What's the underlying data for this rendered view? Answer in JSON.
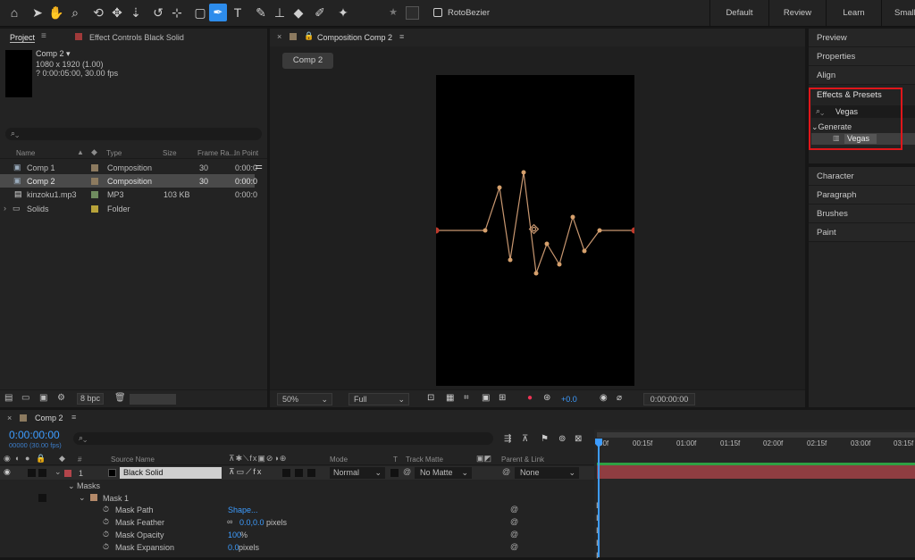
{
  "toolbar": {
    "tool_icons": [
      "home-icon",
      "selection-arrow-icon",
      "hand-icon",
      "zoom-icon",
      "orbit-camera-icon",
      "pan-camera-icon",
      "dolly-camera-icon",
      "rotate-icon",
      "pan-behind-icon",
      "rectangle-icon",
      "pen-icon",
      "type-icon",
      "brush-icon",
      "clone-stamp-icon",
      "eraser-icon",
      "roto-brush-icon",
      "puppet-pin-icon"
    ],
    "rotobezier_label": "RotoBezier",
    "workspaces": [
      "Default",
      "Review",
      "Learn",
      "Small"
    ]
  },
  "project_panel": {
    "tab_project": "Project",
    "tab_effect_controls": "Effect Controls Black Solid",
    "comp_name": "Comp 2",
    "comp_size": "1080 x 1920 (1.00)",
    "comp_duration": "? 0:00:05:00, 30.00 fps",
    "columns": [
      "Name",
      "Type",
      "Size",
      "Frame Ra...",
      "In Point"
    ],
    "items": [
      {
        "name": "Comp 1",
        "type": "Composition",
        "size": "",
        "fps": "30",
        "in": "0:00:0",
        "color": "#8c7a5f"
      },
      {
        "name": "Comp 2",
        "type": "Composition",
        "size": "",
        "fps": "30",
        "in": "0:00:0",
        "color": "#8c7a5f"
      },
      {
        "name": "kinzoku1.mp3",
        "type": "MP3",
        "size": "103 KB",
        "fps": "",
        "in": "0:00:0",
        "color": "#6f8c5f"
      },
      {
        "name": "Solids",
        "type": "Folder",
        "size": "",
        "fps": "",
        "in": "",
        "color": "#b8a33a"
      }
    ],
    "bpc": "8 bpc"
  },
  "viewer": {
    "tab_title": "Composition Comp 2",
    "breadcrumb": "Comp 2",
    "zoom": "50%",
    "resolution": "Full",
    "exposure": "+0.0",
    "timecode": "0:00:00:00"
  },
  "right_panels": {
    "top_items": [
      "Preview",
      "Properties",
      "Align"
    ],
    "effects_title": "Effects & Presets",
    "search_value": "Vegas",
    "category": "Generate",
    "result": "Vegas",
    "bottom_items": [
      "Character",
      "Paragraph",
      "Brushes",
      "Paint"
    ]
  },
  "timeline": {
    "tab": "Comp 2",
    "timecode": "0:00:00:00",
    "fps_label": "00000 (30.00 fps)",
    "header_cols": {
      "hash": "#",
      "source": "Source Name",
      "mode": "Mode",
      "t": "T",
      "matte": "Track Matte",
      "parent": "Parent & Link"
    },
    "layer": {
      "num": "1",
      "name": "Black Solid",
      "mode": "Normal",
      "matte": "No Matte",
      "parent": "None"
    },
    "masks_label": "Masks",
    "mask1_label": "Mask 1",
    "props": [
      {
        "name": "Mask Path",
        "value": "Shape...",
        "unit": ""
      },
      {
        "name": "Mask Feather",
        "value": "0.0,0.0",
        "unit": " pixels"
      },
      {
        "name": "Mask Opacity",
        "value": "100",
        "unit": "%"
      },
      {
        "name": "Mask Expansion",
        "value": "0.0",
        "unit": " pixels"
      }
    ],
    "ruler": [
      "00f",
      "00:15f",
      "01:00f",
      "01:15f",
      "02:00f",
      "02:15f",
      "03:00f",
      "03:15f"
    ]
  },
  "colors": {
    "accent": "#3d9cff",
    "highlight_box": "#e0161a",
    "layer_bar": "#b3454b",
    "mask_color": "#b48a6a"
  }
}
